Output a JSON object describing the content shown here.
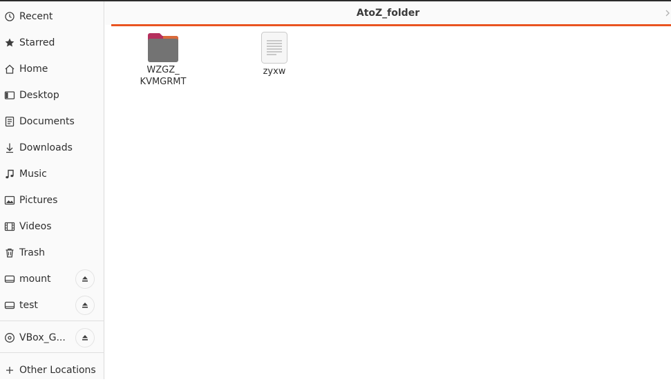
{
  "window": {
    "title": "AtoZ_folder"
  },
  "sidebar": {
    "items": [
      {
        "label": "Recent",
        "icon": "clock-icon"
      },
      {
        "label": "Starred",
        "icon": "star-icon"
      },
      {
        "label": "Home",
        "icon": "home-icon"
      },
      {
        "label": "Desktop",
        "icon": "desktop-icon"
      },
      {
        "label": "Documents",
        "icon": "document-icon"
      },
      {
        "label": "Downloads",
        "icon": "download-icon"
      },
      {
        "label": "Music",
        "icon": "music-icon"
      },
      {
        "label": "Pictures",
        "icon": "picture-icon"
      },
      {
        "label": "Videos",
        "icon": "video-icon"
      },
      {
        "label": "Trash",
        "icon": "trash-icon"
      },
      {
        "label": "mount",
        "icon": "drive-icon",
        "eject": true
      },
      {
        "label": "test",
        "icon": "drive-icon",
        "eject": true
      },
      {
        "label": "VBox_G...",
        "icon": "disc-icon",
        "eject": true
      },
      {
        "label": "Other Locations",
        "icon": "plus-icon"
      }
    ]
  },
  "files": [
    {
      "name_line1": "WZGZ_",
      "name_line2": "KVMGRMT",
      "type": "folder-icon"
    },
    {
      "name_line1": "zyxw",
      "name_line2": "",
      "type": "text-file-icon"
    }
  ],
  "colors": {
    "accent": "#e95420",
    "folder_tab": "#b5305d",
    "folder_body": "#737373"
  }
}
